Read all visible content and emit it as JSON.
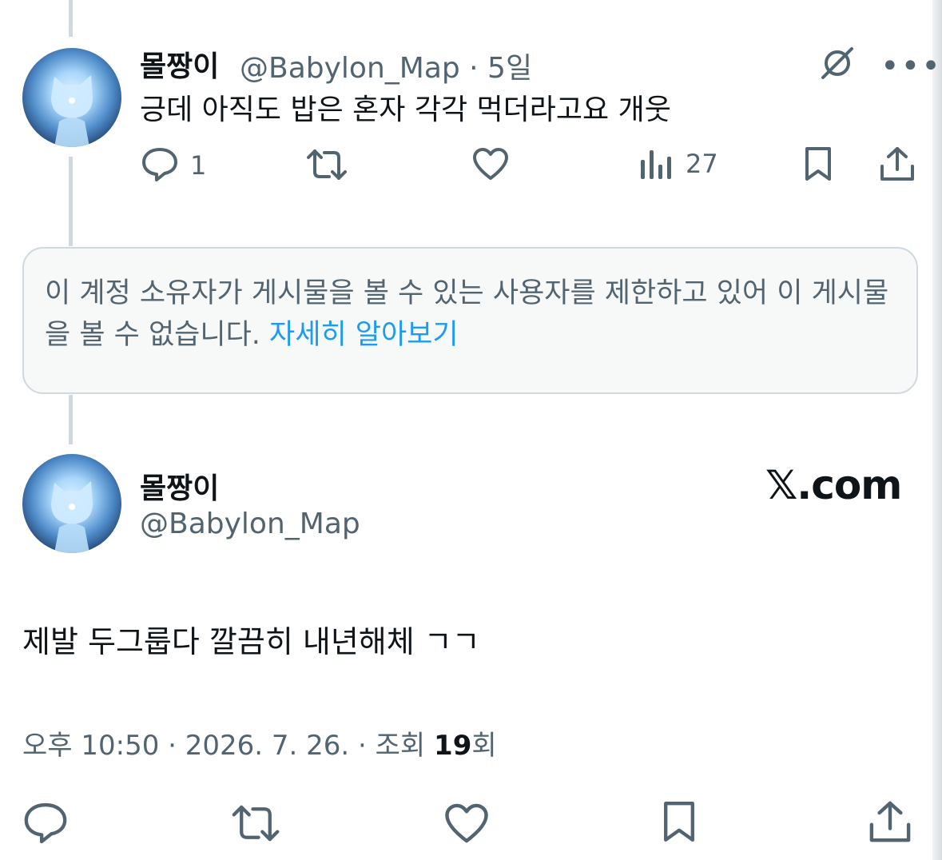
{
  "reply_tweet": {
    "display_name": "몰짱이",
    "handle_time": "@Babylon_Map · 5일",
    "text": "긍데 아직도 밥은 혼자 각각 먹더라고요 개웃",
    "reply_count": "1",
    "view_count": "27",
    "icons": [
      "slashed-circle-icon",
      "more-icon",
      "reply-icon",
      "retweet-icon",
      "like-icon",
      "views-icon",
      "bookmark-icon",
      "share-icon"
    ]
  },
  "restricted_notice": {
    "text": "이 계정 소유자가 게시물을 볼 수 있는 사용자를 제한하고 있어 이 게시물을 볼 수 없습니다.",
    "link": "자세히 알아보기"
  },
  "main_tweet": {
    "display_name": "몰짱이",
    "handle": "@Babylon_Map",
    "brand": "𝕏.com",
    "text": "제발 두그룹다 깔끔히 내년해체 ㄱㄱ",
    "meta_prefix": "오후 10:50 · 2026. 7. 26. · 조회 ",
    "views": "19",
    "meta_suffix": "회",
    "icons": [
      "reply-icon",
      "retweet-icon",
      "like-icon",
      "bookmark-icon",
      "share-icon"
    ]
  },
  "colors": {
    "text": "#0f1419",
    "secondary": "#536471",
    "link": "#1d9bf0",
    "border": "#cfd9de"
  }
}
